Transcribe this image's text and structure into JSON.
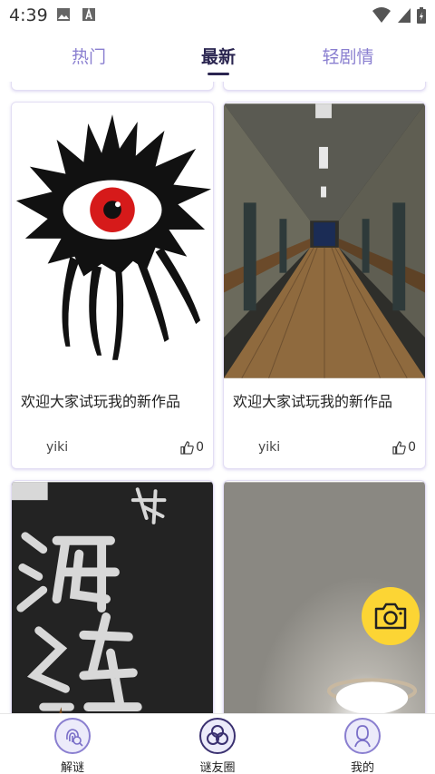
{
  "status_bar": {
    "time": "4:39"
  },
  "tabs": [
    {
      "label": "热门",
      "active": false
    },
    {
      "label": "最新",
      "active": true
    },
    {
      "label": "轻剧情",
      "active": false
    }
  ],
  "posts": [
    {
      "title": "欢迎大家试玩我的新作品",
      "author": "yiki",
      "likes": "0"
    },
    {
      "title": "欢迎大家试玩我的新作品",
      "author": "yiki",
      "likes": "0"
    }
  ],
  "nav": [
    {
      "label": "解谜",
      "icon": "fingerprint-icon",
      "active": false
    },
    {
      "label": "谜友圈",
      "icon": "circles-icon",
      "active": true
    },
    {
      "label": "我的",
      "icon": "profile-icon",
      "active": false
    }
  ],
  "colors": {
    "accent": "#8a7fd0",
    "fab": "#fcd534",
    "tab_active": "#2a2550"
  }
}
